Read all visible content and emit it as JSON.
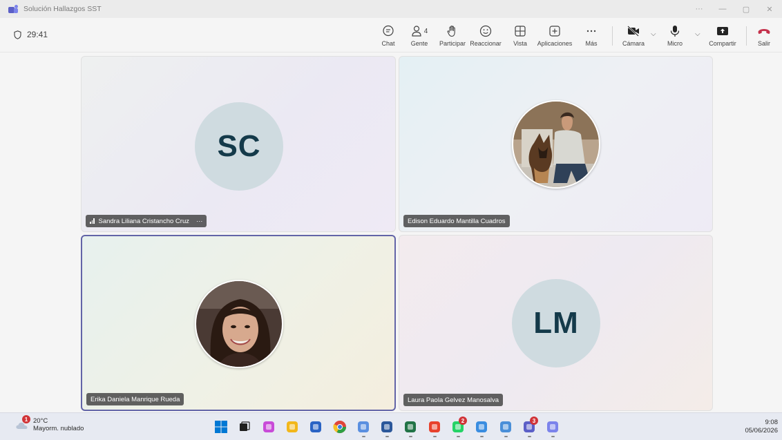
{
  "window": {
    "title": "Solución Hallazgos SST",
    "controls": {
      "more": "···",
      "minimize": "—",
      "restore": "▢",
      "close": "✕"
    }
  },
  "meeting": {
    "timer": "29:41",
    "toolbar": {
      "chat": "Chat",
      "people": "Gente",
      "people_count": "4",
      "raise": "Participar",
      "react": "Reaccionar",
      "view": "Vista",
      "apps": "Aplicaciones",
      "more": "Más",
      "camera": "Cámara",
      "mic": "Micro",
      "share": "Compartir",
      "leave": "Salir"
    }
  },
  "participants": [
    {
      "name": "Sandra Liliana Cristancho Cruz",
      "initials": "SC",
      "type": "initials",
      "speaking": true,
      "more": "···"
    },
    {
      "name": "Edison Eduardo Mantilla Cuadros",
      "type": "photo",
      "photo": "man-with-dog"
    },
    {
      "name": "Erika Daniela Manrique Rueda",
      "type": "photo",
      "photo": "woman-portrait",
      "active": true
    },
    {
      "name": "Laura Paola Gelvez Manosalva",
      "initials": "LM",
      "type": "initials"
    }
  ],
  "taskbar": {
    "weather": {
      "temp": "20°C",
      "desc": "Mayorm. nublado",
      "badge": "1"
    },
    "apps": [
      {
        "name": "start",
        "color": "#0078d4"
      },
      {
        "name": "task-view",
        "color": "#1f1f1f"
      },
      {
        "name": "copilot",
        "color": "#c84bd8"
      },
      {
        "name": "file-explorer",
        "color": "#f2b71b"
      },
      {
        "name": "store",
        "color": "#2a63c4"
      },
      {
        "name": "chrome",
        "color": "#e0453a"
      },
      {
        "name": "chrome-profile",
        "color": "#5a8fe0"
      },
      {
        "name": "word",
        "color": "#2b579a"
      },
      {
        "name": "excel",
        "color": "#217346"
      },
      {
        "name": "acrobat",
        "color": "#e8412c"
      },
      {
        "name": "whatsapp",
        "color": "#25d366",
        "badge": "2"
      },
      {
        "name": "snipping-tool",
        "color": "#3a8de0"
      },
      {
        "name": "news",
        "color": "#4a8fd8"
      },
      {
        "name": "teams-classic",
        "color": "#5b5fc7",
        "badge": "3"
      },
      {
        "name": "teams",
        "color": "#7b83eb"
      }
    ],
    "clock": {
      "time": "9:08",
      "date": "05/06/2026"
    }
  },
  "colors": {
    "accent": "#6264a7",
    "leave": "#c4314b",
    "avatar_bg": "#cfdbe0",
    "avatar_text": "#143a4a"
  }
}
